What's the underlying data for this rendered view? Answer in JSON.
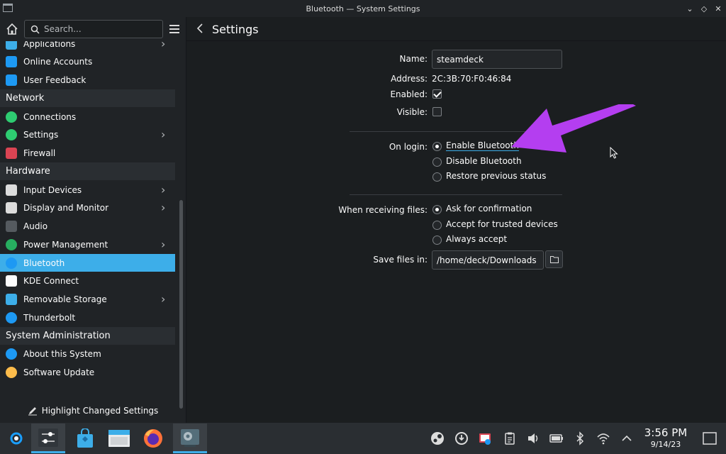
{
  "window": {
    "title": "Bluetooth — System Settings"
  },
  "sidebar": {
    "search_placeholder": "Search...",
    "items": [
      {
        "type": "item",
        "label": "Applications",
        "icon": "applications-icon",
        "chevron": true,
        "color": "#3daee9"
      },
      {
        "type": "item",
        "label": "Online Accounts",
        "icon": "online-accounts-icon",
        "chevron": false,
        "color": "#1d99f3"
      },
      {
        "type": "item",
        "label": "User Feedback",
        "icon": "user-feedback-icon",
        "chevron": false,
        "color": "#1d99f3"
      },
      {
        "type": "section",
        "label": "Network"
      },
      {
        "type": "item",
        "label": "Connections",
        "icon": "globe-icon",
        "chevron": false,
        "color": "#2ecc71"
      },
      {
        "type": "item",
        "label": "Settings",
        "icon": "globe-settings-icon",
        "chevron": true,
        "color": "#2ecc71"
      },
      {
        "type": "item",
        "label": "Firewall",
        "icon": "firewall-icon",
        "chevron": false,
        "color": "#da4453"
      },
      {
        "type": "section",
        "label": "Hardware"
      },
      {
        "type": "item",
        "label": "Input Devices",
        "icon": "mouse-icon",
        "chevron": true,
        "color": "#dcdcdc"
      },
      {
        "type": "item",
        "label": "Display and Monitor",
        "icon": "monitor-icon",
        "chevron": true,
        "color": "#dcdcdc"
      },
      {
        "type": "item",
        "label": "Audio",
        "icon": "speaker-icon",
        "chevron": false,
        "color": "#555a5f"
      },
      {
        "type": "item",
        "label": "Power Management",
        "icon": "power-icon",
        "chevron": true,
        "color": "#27ae60"
      },
      {
        "type": "item",
        "label": "Bluetooth",
        "icon": "bluetooth-icon",
        "chevron": false,
        "color": "#1d99f3",
        "selected": true
      },
      {
        "type": "item",
        "label": "KDE Connect",
        "icon": "kde-connect-icon",
        "chevron": false,
        "color": "#fcfcfc"
      },
      {
        "type": "item",
        "label": "Removable Storage",
        "icon": "usb-icon",
        "chevron": true,
        "color": "#3daee9"
      },
      {
        "type": "item",
        "label": "Thunderbolt",
        "icon": "thunderbolt-icon",
        "chevron": false,
        "color": "#1d99f3"
      },
      {
        "type": "section",
        "label": "System Administration"
      },
      {
        "type": "item",
        "label": "About this System",
        "icon": "info-icon",
        "chevron": false,
        "color": "#1d99f3"
      },
      {
        "type": "item",
        "label": "Software Update",
        "icon": "software-update-icon",
        "chevron": false,
        "color": "#fdbc4b"
      }
    ],
    "highlight_label": "Highlight Changed Settings"
  },
  "content": {
    "title": "Settings",
    "name_label": "Name:",
    "name_value": "steamdeck",
    "address_label": "Address:",
    "address_value": "2C:3B:70:F0:46:84",
    "enabled_label": "Enabled:",
    "enabled_checked": true,
    "visible_label": "Visible:",
    "visible_checked": false,
    "onlogin_label": "On login:",
    "onlogin_options": [
      "Enable Bluetooth",
      "Disable Bluetooth",
      "Restore previous status"
    ],
    "onlogin_selected": 0,
    "receiving_label": "When receiving files:",
    "receiving_options": [
      "Ask for confirmation",
      "Accept for trusted devices",
      "Always accept"
    ],
    "receiving_selected": 0,
    "save_label": "Save files in:",
    "save_value": "/home/deck/Downloads"
  },
  "annotation": {
    "arrow_color": "#b43ef0"
  },
  "taskbar": {
    "apps": [
      "steam-deck-menu-icon",
      "system-settings-icon",
      "discover-icon",
      "dolphin-icon",
      "firefox-icon",
      "system-settings-window-icon"
    ],
    "tray": [
      "steam-icon",
      "update-icon",
      "screenshot-icon",
      "clipboard-icon",
      "volume-icon",
      "battery-icon",
      "bluetooth-icon",
      "wifi-icon",
      "chevron-up-icon"
    ],
    "time": "3:56 PM",
    "date": "9/14/23"
  },
  "colors": {
    "accent": "#3daee9",
    "window_bg": "#1b1e20",
    "sidebar_bg": "#202326"
  }
}
